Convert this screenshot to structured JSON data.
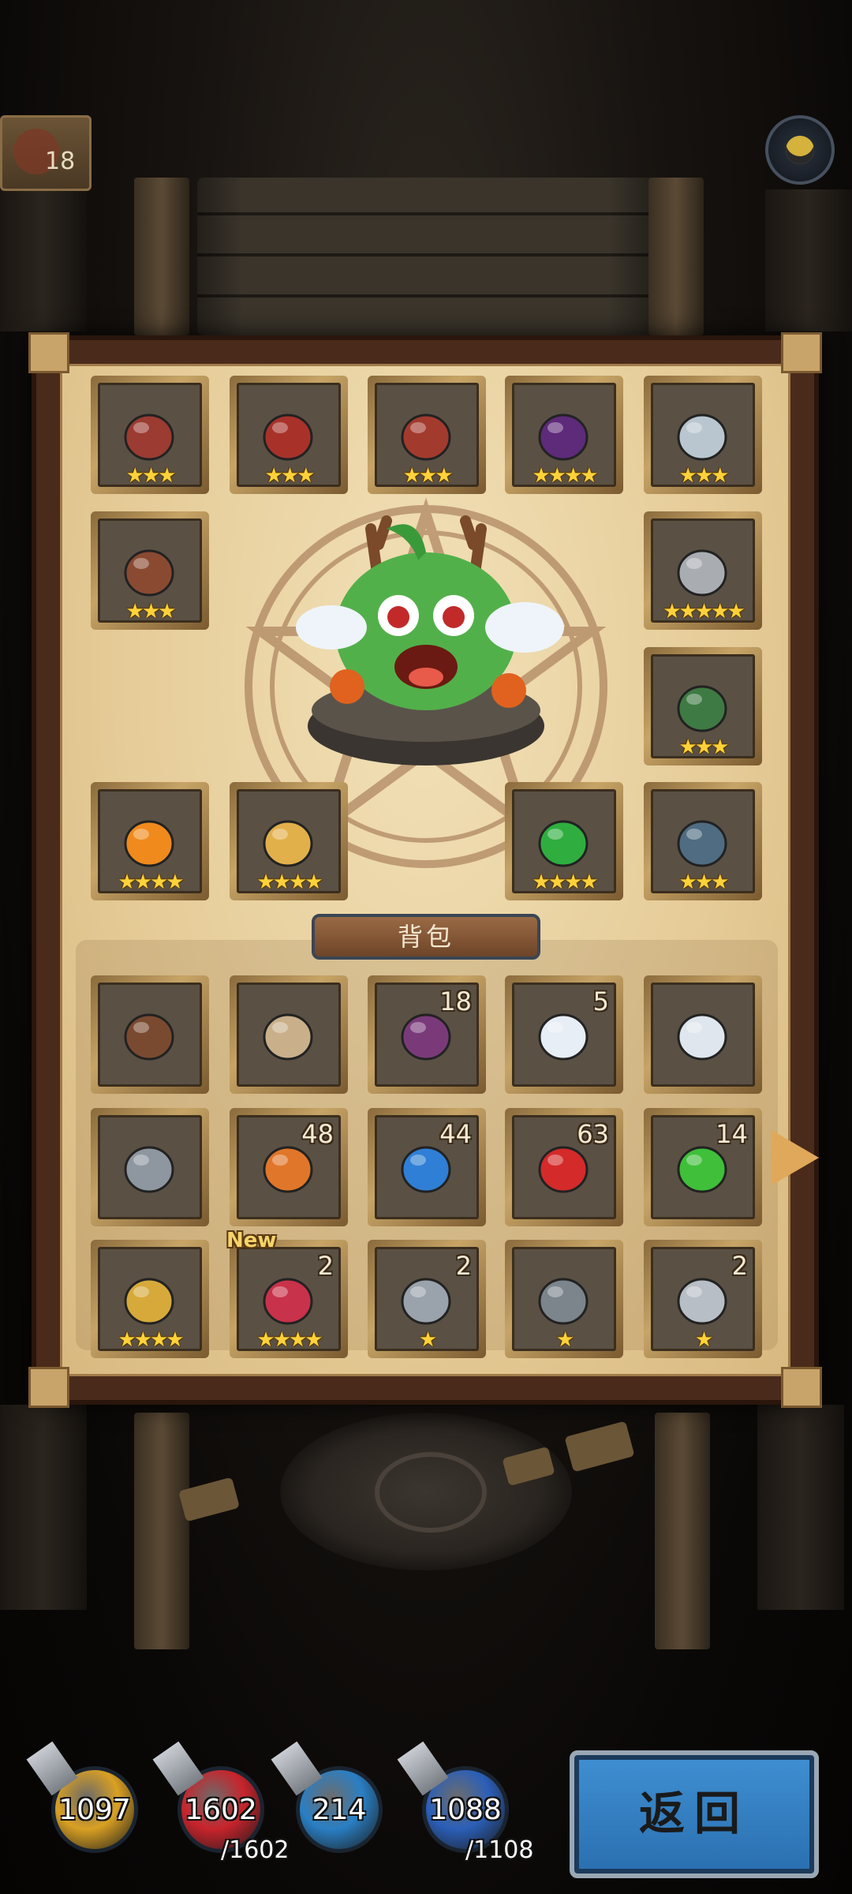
{
  "top_bar": {
    "left_counter": "18"
  },
  "equipment": [
    {
      "name": "gauntlet-icon",
      "stars": "★★★",
      "color": "#9b3b32"
    },
    {
      "name": "chest-armor-icon",
      "stars": "★★★",
      "color": "#a8322a"
    },
    {
      "name": "helmet-icon",
      "stars": "★★★",
      "color": "#a33a2e"
    },
    {
      "name": "witch-hat-icon",
      "stars": "★★★★",
      "color": "#5e2a7a"
    },
    {
      "name": "amulet-icon",
      "stars": "★★★",
      "color": "#b9c6cf"
    },
    {
      "name": "belt-icon",
      "stars": "★★★",
      "color": "#8a4a32"
    },
    {
      "name": "ring-icon",
      "stars": "★★★★★",
      "color": "#a9adb2"
    },
    {
      "name": "cloak-icon",
      "stars": "★★★",
      "color": "#3e7a43"
    },
    {
      "name": "gourd-icon",
      "stars": "★★★★",
      "color": "#f08a1c"
    },
    {
      "name": "spellbook-icon",
      "stars": "★★★★",
      "color": "#e2b04a"
    },
    {
      "name": "green-heart-icon",
      "stars": "★★★★",
      "color": "#2fae3f"
    },
    {
      "name": "boots-icon",
      "stars": "★★★",
      "color": "#4f6c82"
    }
  ],
  "bag": {
    "title": "背包",
    "items": [
      {
        "name": "book-icon",
        "qty": "",
        "stars": "",
        "new": "",
        "color": "#7a4a30"
      },
      {
        "name": "compass-icon",
        "qty": "",
        "stars": "",
        "new": "",
        "color": "#c9b08a"
      },
      {
        "name": "rope-icon",
        "qty": "18",
        "stars": "",
        "new": "",
        "color": "#7a3a7a"
      },
      {
        "name": "ghost-icon",
        "qty": "5",
        "stars": "",
        "new": "",
        "color": "#e8eef6"
      },
      {
        "name": "angry-ghost-icon",
        "qty": "",
        "stars": "",
        "new": "",
        "color": "#dfe6ee"
      },
      {
        "name": "pistol-icon",
        "qty": "",
        "stars": "",
        "new": "",
        "color": "#8e96a0"
      },
      {
        "name": "orange-crystal-icon",
        "qty": "48",
        "stars": "",
        "new": "",
        "color": "#e0762a"
      },
      {
        "name": "blue-crystal-icon",
        "qty": "44",
        "stars": "",
        "new": "",
        "color": "#2f7fd6"
      },
      {
        "name": "red-crystal-icon",
        "qty": "63",
        "stars": "",
        "new": "",
        "color": "#d42a2a"
      },
      {
        "name": "green-crystal-icon",
        "qty": "14",
        "stars": "",
        "new": "",
        "color": "#3fbf3a"
      },
      {
        "name": "gold-heart-icon",
        "qty": "",
        "stars": "★★★★",
        "new": "",
        "color": "#d6a93a"
      },
      {
        "name": "red-heart-icon",
        "qty": "2",
        "stars": "★★★★",
        "new": "New",
        "color": "#c8324a"
      },
      {
        "name": "armor-icon",
        "qty": "2",
        "stars": "★",
        "new": "",
        "color": "#9aa2ac"
      },
      {
        "name": "gauntlet-steel-icon",
        "qty": "",
        "stars": "★",
        "new": "",
        "color": "#7c848c"
      },
      {
        "name": "silver-ring-icon",
        "qty": "2",
        "stars": "★",
        "new": "",
        "color": "#b8bec6"
      }
    ]
  },
  "stats": [
    {
      "name": "attack-stat",
      "value": "1097",
      "max": "",
      "color": "#d9a023"
    },
    {
      "name": "health-stat",
      "value": "1602",
      "max": "/1602",
      "color": "#c8242c"
    },
    {
      "name": "defense-stat",
      "value": "214",
      "max": "",
      "color": "#2a7fc4"
    },
    {
      "name": "mana-stat",
      "value": "1088",
      "max": "/1108",
      "color": "#2b5fb8"
    }
  ],
  "back_button": {
    "label": "返回"
  }
}
